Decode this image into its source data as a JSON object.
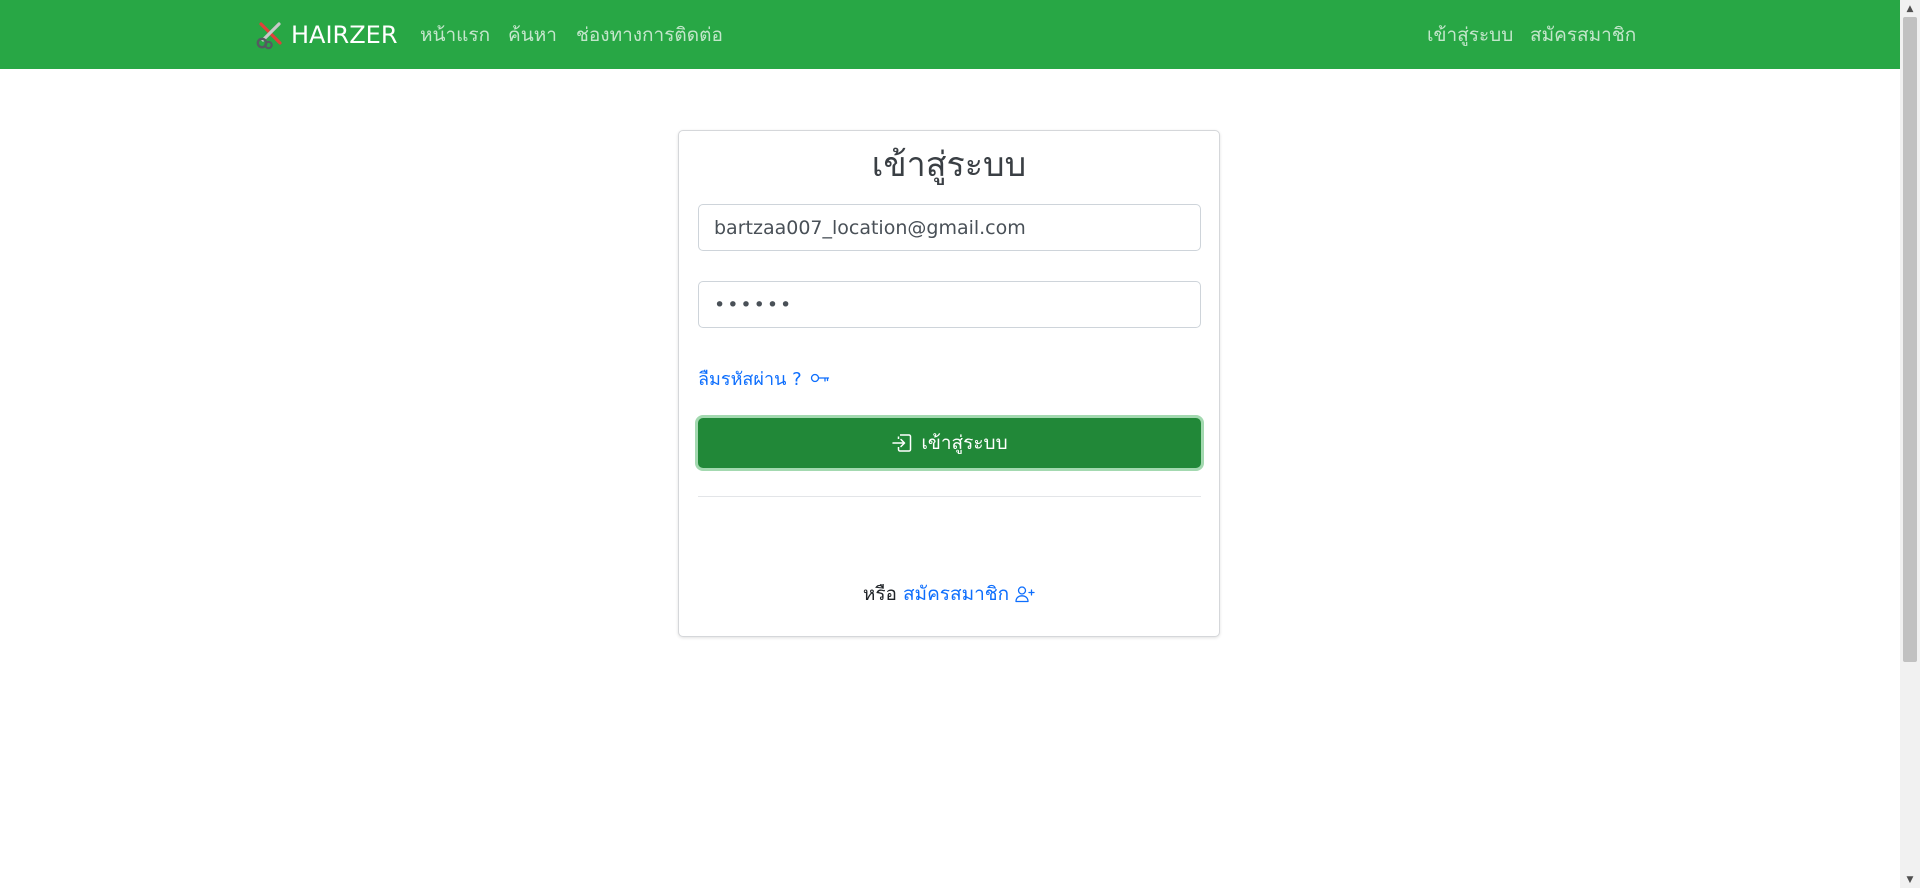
{
  "navbar": {
    "brand": "HAIRZER",
    "brand_icon": "scissors-icon",
    "background": "#28a745",
    "links": [
      {
        "label": "หน้าแรก"
      },
      {
        "label": "ค้นหา"
      },
      {
        "label": "ช่องทางการติดต่อ"
      }
    ],
    "right_links": [
      {
        "label": "เข้าสู่ระบบ"
      },
      {
        "label": "สมัครสมาชิก"
      }
    ]
  },
  "login_card": {
    "title": "เข้าสู่ระบบ",
    "email_value": "bartzaa007_location@gmail.com",
    "password_value": "••••••",
    "forgot_label": "ลืมรหัสผ่าน ?",
    "forgot_icon": "key-icon",
    "submit_label": "เข้าสู่ระบบ",
    "submit_icon": "login-icon",
    "submit_color": "#218838",
    "or_text": "หรือ",
    "register_label": "สมัครสมาชิก",
    "register_icon": "person-add-icon",
    "link_color": "#0d6efd"
  }
}
